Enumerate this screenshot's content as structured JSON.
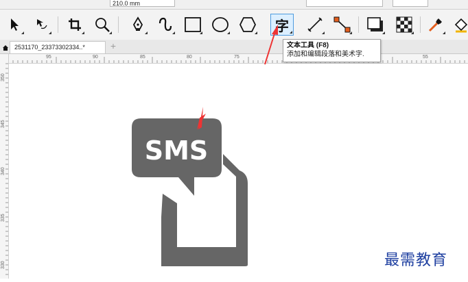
{
  "property_bar": {
    "width_value": "210.0 mm"
  },
  "toolbox": {
    "tools": [
      {
        "name": "pick-tool"
      },
      {
        "name": "shape-tool"
      },
      {
        "name": "crop-tool"
      },
      {
        "name": "zoom-tool"
      },
      {
        "name": "pen-tool"
      },
      {
        "name": "artistic-media-tool"
      },
      {
        "name": "rectangle-tool"
      },
      {
        "name": "ellipse-tool"
      },
      {
        "name": "polygon-tool"
      },
      {
        "name": "text-tool",
        "glyph": "字",
        "active": true
      },
      {
        "name": "parallel-dimension-tool"
      },
      {
        "name": "connector-tool"
      },
      {
        "name": "drop-shadow-tool"
      },
      {
        "name": "transparency-tool"
      },
      {
        "name": "eyedropper-tool"
      },
      {
        "name": "interactive-fill-tool"
      }
    ]
  },
  "document_tab": {
    "name": "2531170_23373302334..*"
  },
  "ruler": {
    "horizontal_labels": [
      "95",
      "90",
      "85",
      "80",
      "75",
      "55"
    ],
    "vertical_labels": [
      "350",
      "345",
      "340",
      "335",
      "330"
    ]
  },
  "tooltip": {
    "title": "文本工具 (F8)",
    "description": "添加和编辑段落和美术字."
  },
  "artwork": {
    "text": "SMS",
    "fill_color": "#666666",
    "text_color": "#ffffff"
  },
  "annotation_color": "#ee3333",
  "watermark": "最需教育"
}
